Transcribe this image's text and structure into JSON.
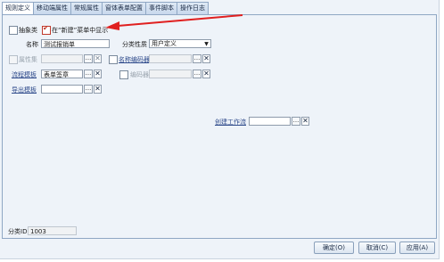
{
  "tabs": [
    "规则定义",
    "移动端属性",
    "常规属性",
    "窗体表单配置",
    "事件脚本",
    "操作日志"
  ],
  "abstract_label": "抽象类",
  "show_in_new_menu_label": "在“新建”菜单中显示",
  "name_label": "名称",
  "name_value": "测试报销单",
  "category_nature_label": "分类性质",
  "category_nature_value": "用户定义",
  "attribute_set_label": "属性集",
  "name_encoder_label": "名称编码器",
  "process_template_label": "流程模板",
  "process_template_value": "表单签章",
  "encoder_label": "编码器",
  "export_template_label": "导出模板",
  "create_workflow_label": "创建工作流",
  "category_id_label": "分类ID",
  "category_id_value": "1003",
  "dots_label": "...",
  "clear_glyph": "✕",
  "buttons": {
    "ok": "确定(O)",
    "cancel": "取消(C)",
    "apply": "应用(A)"
  }
}
